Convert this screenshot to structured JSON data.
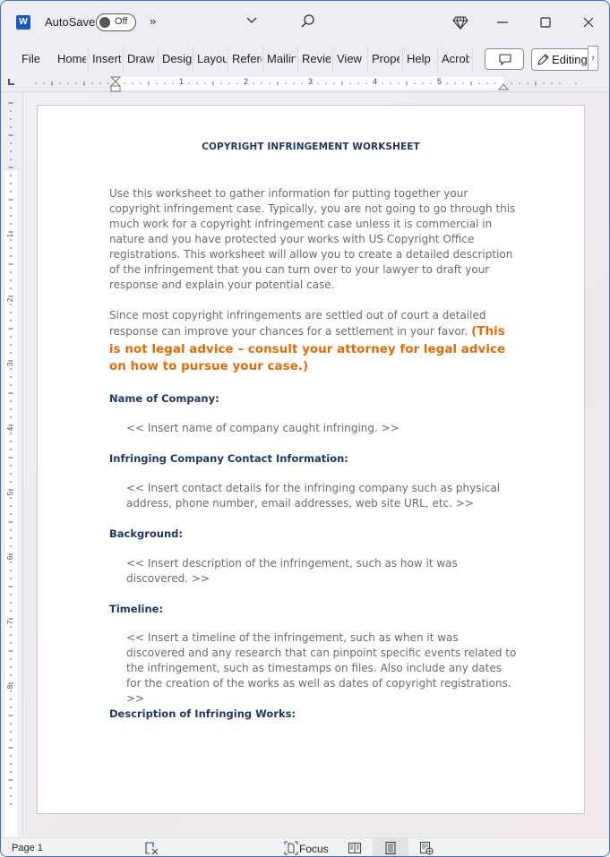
{
  "titlebar": {
    "app_icon": "word-icon",
    "autosave_label": "AutoSave",
    "autosave_state": "Off",
    "more_commands": "»",
    "title_dropdown": "⌄"
  },
  "ribbon": {
    "tabs": [
      "File",
      "Home",
      "Insert",
      "Draw",
      "Design",
      "Layout",
      "References",
      "Mailings",
      "Review",
      "View",
      "Properties",
      "Help",
      "Acrobat"
    ],
    "editing_label": "Editing",
    "scroll_right": "›"
  },
  "ruler": {
    "numbers": [
      "1",
      "2",
      "3",
      "4",
      "5"
    ],
    "vertical_numbers": [
      "1",
      "2",
      "3",
      "4",
      "5",
      "6",
      "7",
      "8"
    ]
  },
  "document": {
    "title": "COPYRIGHT INFRINGEMENT WORKSHEET",
    "intro": "Use this worksheet to gather information for putting together your copyright infringement case. Typically, you are not going to go through this much work for a copyright infringement case unless it is commercial in nature and you have protected your works with US Copyright Office registrations. This worksheet will allow you to create a detailed description of the infringement that you can turn over to your lawyer to draft your response and explain your potential case.",
    "settle": "Since most copyright infringements are settled out of court a detailed response can improve your chances for a settlement in your favor.",
    "warning": "(This is not legal advice  – consult your attorney for legal advice on how to pursue your case.)",
    "sections": [
      {
        "heading": "Name of Company:",
        "placeholder": "<< Insert name of company caught infringing. >>"
      },
      {
        "heading": "Infringing Company Contact Information:",
        "placeholder": "<< Insert contact details for the infringing company such as physical address, phone number, email addresses, web site URL, etc. >>"
      },
      {
        "heading": "Background:",
        "placeholder": "<< Insert description of the infringement, such as how it was discovered. >>"
      },
      {
        "heading": "Timeline:",
        "placeholder": "<< Insert a timeline of the infringement, such as when it was discovered and any research that can pinpoint specific events related to the infringement, such as timestamps on files. Also include any dates for the creation of the works as well as dates of copyright registrations. >>"
      },
      {
        "heading": "Description of Infringing Works:",
        "placeholder": ""
      }
    ]
  },
  "statusbar": {
    "page": "Page 1",
    "focus_label": "Focus"
  },
  "colors": {
    "heading": "#1f3864",
    "body_text": "#6b6b6b",
    "warning": "#e36c09",
    "word_brand": "#185abd"
  }
}
